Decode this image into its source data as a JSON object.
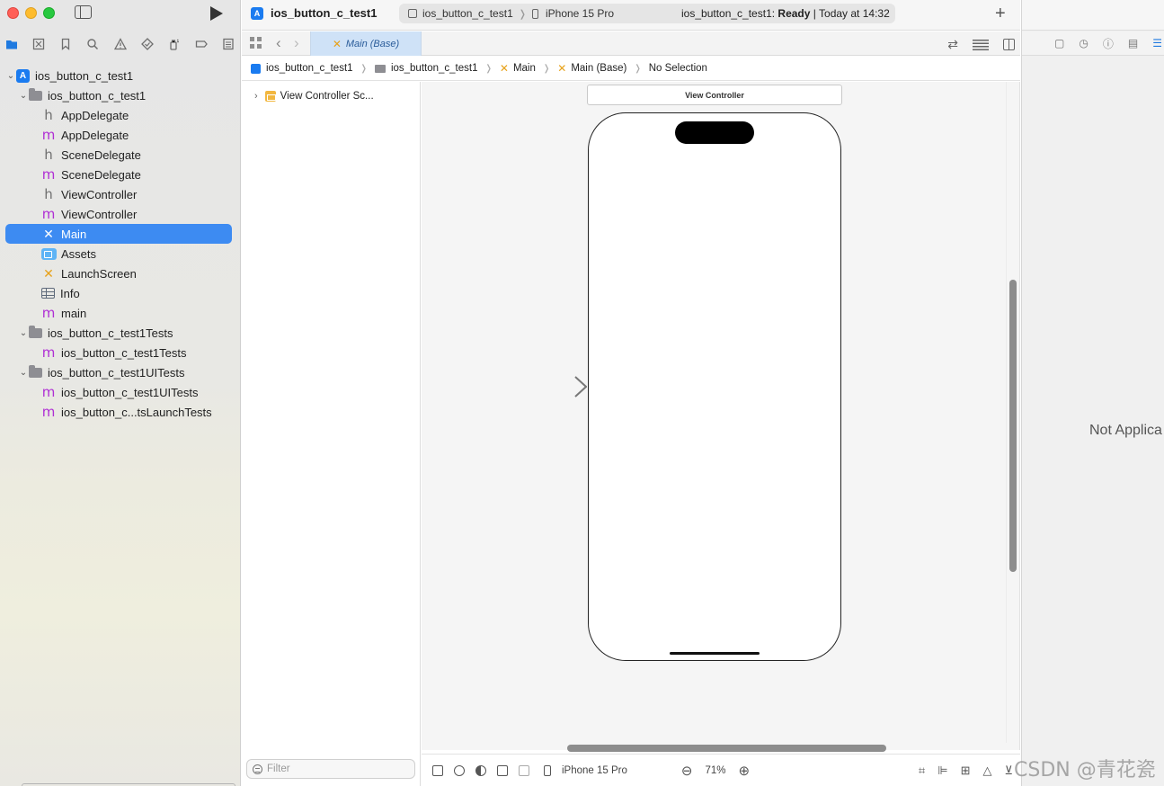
{
  "navigator": {
    "project_root": "ios_button_c_test1",
    "tree": [
      {
        "label": "ios_button_c_test1",
        "icon": "project-icon",
        "level": 0,
        "expanded": true
      },
      {
        "label": "ios_button_c_test1",
        "icon": "folder-icon",
        "level": 1,
        "expanded": true
      },
      {
        "label": "AppDelegate",
        "icon": "header-file-icon",
        "glyph": "h",
        "level": 2
      },
      {
        "label": "AppDelegate",
        "icon": "objc-file-icon",
        "glyph": "m",
        "level": 2
      },
      {
        "label": "SceneDelegate",
        "icon": "header-file-icon",
        "glyph": "h",
        "level": 2
      },
      {
        "label": "SceneDelegate",
        "icon": "objc-file-icon",
        "glyph": "m",
        "level": 2
      },
      {
        "label": "ViewController",
        "icon": "header-file-icon",
        "glyph": "h",
        "level": 2
      },
      {
        "label": "ViewController",
        "icon": "objc-file-icon",
        "glyph": "m",
        "level": 2
      },
      {
        "label": "Main",
        "icon": "storyboard-icon",
        "level": 2,
        "selected": true
      },
      {
        "label": "Assets",
        "icon": "assets-icon",
        "level": 2
      },
      {
        "label": "LaunchScreen",
        "icon": "storyboard-icon",
        "level": 2
      },
      {
        "label": "Info",
        "icon": "plist-icon",
        "level": 2
      },
      {
        "label": "main",
        "icon": "objc-file-icon",
        "glyph": "m",
        "level": 2
      },
      {
        "label": "ios_button_c_test1Tests",
        "icon": "folder-icon",
        "level": 1,
        "expanded": true
      },
      {
        "label": "ios_button_c_test1Tests",
        "icon": "objc-file-icon",
        "glyph": "m",
        "level": 2
      },
      {
        "label": "ios_button_c_test1UITests",
        "icon": "folder-icon",
        "level": 1,
        "expanded": true
      },
      {
        "label": "ios_button_c_test1UITests",
        "icon": "objc-file-icon",
        "glyph": "m",
        "level": 2
      },
      {
        "label": "ios_button_c...tsLaunchTests",
        "icon": "objc-file-icon",
        "glyph": "m",
        "level": 2
      }
    ],
    "filter_placeholder": "Filter"
  },
  "toolbar": {
    "project_title": "ios_button_c_test1",
    "scheme": "ios_button_c_test1",
    "destination": "iPhone 15 Pro",
    "status_prefix": "ios_button_c_test1:",
    "status_state": "Ready",
    "status_time": "| Today at 14:32",
    "add_label": "+"
  },
  "tabs": {
    "active_tab": "Main (Base)"
  },
  "jumpbar": {
    "items": [
      "ios_button_c_test1",
      "ios_button_c_test1",
      "Main",
      "Main (Base)",
      "No Selection"
    ]
  },
  "outline": {
    "scene_label": "View Controller Sc...",
    "filter_placeholder": "Filter"
  },
  "canvas": {
    "scene_title": "View Controller",
    "device": "iPhone 15 Pro",
    "zoom": "71%"
  },
  "inspector": {
    "message": "Not Applica"
  },
  "watermark": "CSDN @青花瓷",
  "colors": {
    "selection": "#3d8bf2",
    "accent": "#1f7ae0",
    "objc_file": "#b02fd4",
    "storyboard": "#e7a21a"
  }
}
